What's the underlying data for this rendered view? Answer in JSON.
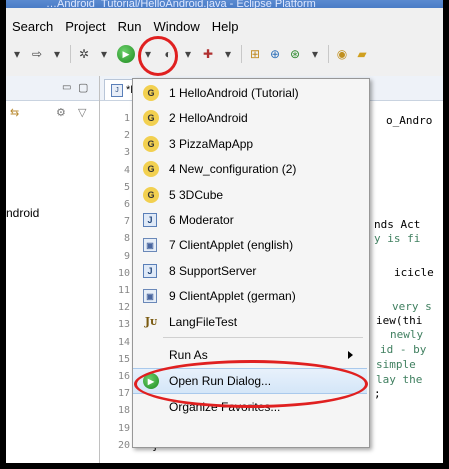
{
  "window_title": "…Android_Tutorial/HelloAndroid.java - Eclipse Platform",
  "menubar": {
    "items": [
      "Search",
      "Project",
      "Run",
      "Window",
      "Help"
    ]
  },
  "left_panel": {
    "label": "ndroid"
  },
  "editor": {
    "tab_label": "*H",
    "line_numbers": [
      "1",
      "2",
      "3",
      "4",
      "5",
      "6",
      "7",
      "8",
      "9",
      "10",
      "11",
      "12",
      "13",
      "14",
      "15",
      "16",
      "17",
      "18",
      "19",
      "20"
    ],
    "fragments": {
      "top_right": "o_Andro",
      "line7": "nds Act",
      "line8": "y is fi",
      "line10": "icicle",
      "line12": "very s",
      "line13": "iew(thi",
      "line14": "newly",
      "line15": "id - by",
      "line16": "simple",
      "line17": "lay the",
      "line18": ";",
      "line19": "}",
      "line20": "}"
    }
  },
  "run_dropdown": {
    "history": [
      {
        "label": "1 HelloAndroid (Tutorial)",
        "icon": "android-icon"
      },
      {
        "label": "2 HelloAndroid",
        "icon": "android-icon"
      },
      {
        "label": "3 PizzaMapApp",
        "icon": "android-icon"
      },
      {
        "label": "4 New_configuration (2)",
        "icon": "android-icon"
      },
      {
        "label": "5 3DCube",
        "icon": "android-icon"
      },
      {
        "label": "6 Moderator",
        "icon": "java-app-icon"
      },
      {
        "label": "7 ClientApplet (english)",
        "icon": "applet-icon"
      },
      {
        "label": "8 SupportServer",
        "icon": "java-app-icon"
      },
      {
        "label": "9 ClientApplet (german)",
        "icon": "applet-icon"
      },
      {
        "label": "LangFileTest",
        "icon": "junit-icon"
      }
    ],
    "run_as": "Run As",
    "open_run_dialog": "Open Run Dialog...",
    "organize_favorites": "Organize Favorites..."
  },
  "colors": {
    "annotation": "#e02020",
    "highlight": "#d4e6f8"
  }
}
